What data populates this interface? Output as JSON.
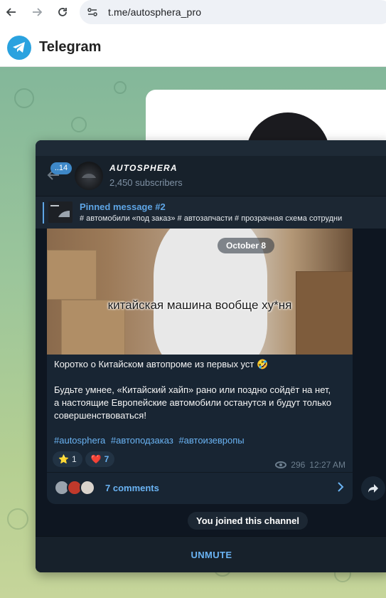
{
  "browser": {
    "url": "t.me/autosphera_pro"
  },
  "header": {
    "title": "Telegram"
  },
  "channel": {
    "name": "AUTOSPHERA",
    "subscribers": "2,450 subscribers",
    "unread_badge": "..14"
  },
  "pinned": {
    "title": "Pinned message #2",
    "text": "# автомобили «под заказ» # автозапчасти  # прозрачная схема сотрудни"
  },
  "post": {
    "date_pill": "October 8",
    "media_caption": "китайская машина вообще ху*ня",
    "lines": [
      "Коротко о Китайском автопроме из первых уст 🤣",
      "",
      "Будьте умнее, «Китайский хайп» рано или поздно сойдёт на нет,",
      "а настоящие Европейские автомобили останутся и будут только",
      "совершенствоваться!"
    ],
    "hashtags": [
      "#autosphera",
      "#автоподзаказ",
      "#автоизевропы"
    ],
    "reactions": [
      {
        "emoji": "⭐",
        "count": "1"
      },
      {
        "emoji": "❤️",
        "count": "7"
      }
    ],
    "views": "296",
    "time": "12:27 AM",
    "comments": "7 comments"
  },
  "service": {
    "joined": "You joined this channel"
  },
  "footer": {
    "unmute": "UNMUTE"
  },
  "colors": {
    "accent": "#6ab3f3",
    "window_bg": "#17212b",
    "chat_bg": "#0e1621",
    "bubble_bg": "#182533",
    "telegram_blue": "#2aa2df"
  }
}
